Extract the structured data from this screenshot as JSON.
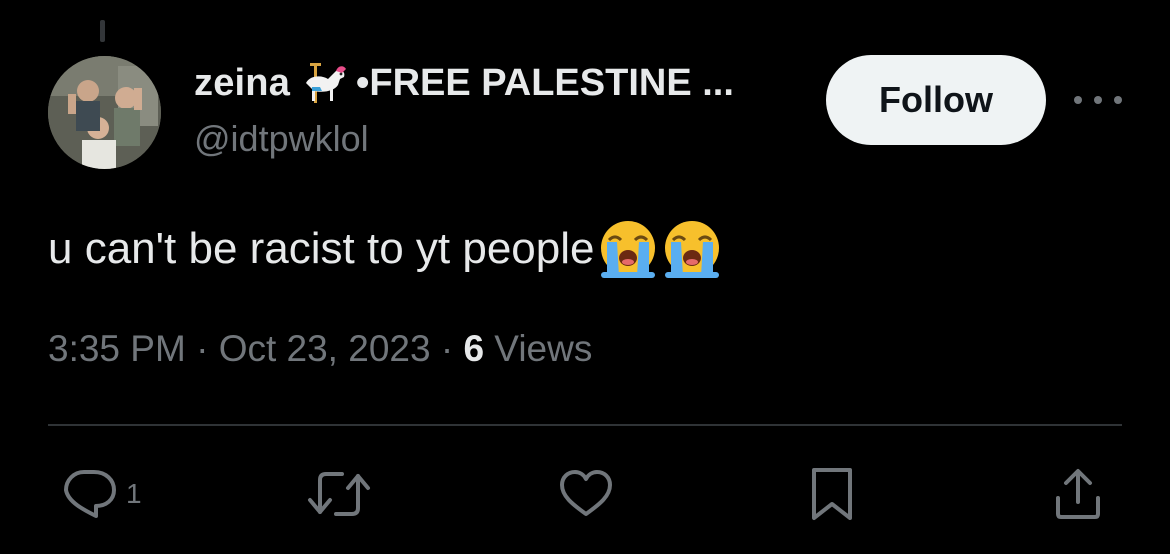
{
  "author": {
    "display_name": "zeina",
    "name_suffix": "•FREE PALESTINE ...",
    "handle": "@idtpwklol",
    "name_icon": "carousel-horse-icon",
    "avatar": "profile-photo"
  },
  "follow_button": {
    "label": "Follow"
  },
  "tweet": {
    "text": "u can't be racist to yt people",
    "emojis": [
      "loudly-crying-face-icon",
      "loudly-crying-face-icon"
    ]
  },
  "meta": {
    "time": "3:35 PM",
    "sep1": " · ",
    "date": "Oct 23, 2023",
    "sep2": " · ",
    "views_count": "6",
    "views_label": " Views"
  },
  "actions": {
    "reply": {
      "icon": "reply-icon",
      "count": "1"
    },
    "retweet": {
      "icon": "retweet-icon"
    },
    "like": {
      "icon": "heart-icon"
    },
    "bookmark": {
      "icon": "bookmark-icon"
    },
    "share": {
      "icon": "share-icon"
    }
  },
  "colors": {
    "background": "#000000",
    "primary_text": "#e7e9ea",
    "secondary_text": "#71767b",
    "divider": "#2f3336",
    "follow_bg": "#eff3f4"
  }
}
